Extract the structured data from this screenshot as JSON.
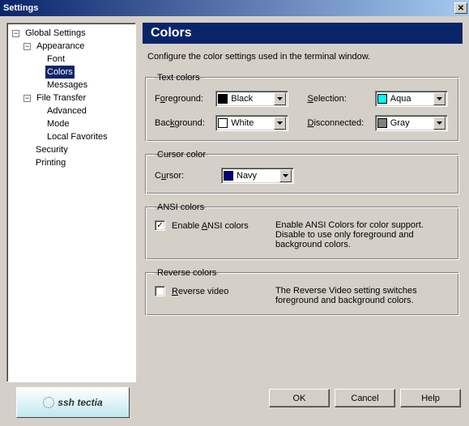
{
  "window": {
    "title": "Settings"
  },
  "tree": {
    "root": "Global Settings",
    "appearance": "Appearance",
    "font": "Font",
    "colors": "Colors",
    "messages": "Messages",
    "file_transfer": "File Transfer",
    "advanced": "Advanced",
    "mode": "Mode",
    "local_favorites": "Local Favorites",
    "security": "Security",
    "printing": "Printing"
  },
  "page": {
    "title": "Colors",
    "description": "Configure the color settings used in the terminal window."
  },
  "text_colors": {
    "legend": "Text colors",
    "foreground_label_pre": "F",
    "foreground_label_accel": "o",
    "foreground_label_post": "reground:",
    "foreground": {
      "name": "Black",
      "hex": "#000000"
    },
    "background_label_pre": "Bac",
    "background_label_accel": "k",
    "background_label_post": "ground:",
    "background": {
      "name": "White",
      "hex": "#ffffff"
    },
    "selection_label_pre": "",
    "selection_label_accel": "S",
    "selection_label_post": "election:",
    "selection": {
      "name": "Aqua",
      "hex": "#00ffff"
    },
    "disconnected_label_pre": "",
    "disconnected_label_accel": "D",
    "disconnected_label_post": "isconnected:",
    "disconnected": {
      "name": "Gray",
      "hex": "#808080"
    }
  },
  "cursor": {
    "legend": "Cursor color",
    "label_pre": "C",
    "label_accel": "u",
    "label_post": "rsor:",
    "value": {
      "name": "Navy",
      "hex": "#000080"
    }
  },
  "ansi": {
    "legend": "ANSI colors",
    "check_pre": "Enable ",
    "check_accel": "A",
    "check_post": "NSI colors",
    "checked": true,
    "description": "Enable ANSI Colors for color support. Disable to use only foreground and background colors."
  },
  "reverse": {
    "legend": "Reverse colors",
    "check_pre": "",
    "check_accel": "R",
    "check_post": "everse video",
    "checked": false,
    "description": "The Reverse Video setting switches foreground and background colors."
  },
  "buttons": {
    "ok": "OK",
    "cancel": "Cancel",
    "help": "Help"
  },
  "logo": {
    "text": "ssh tectia"
  }
}
